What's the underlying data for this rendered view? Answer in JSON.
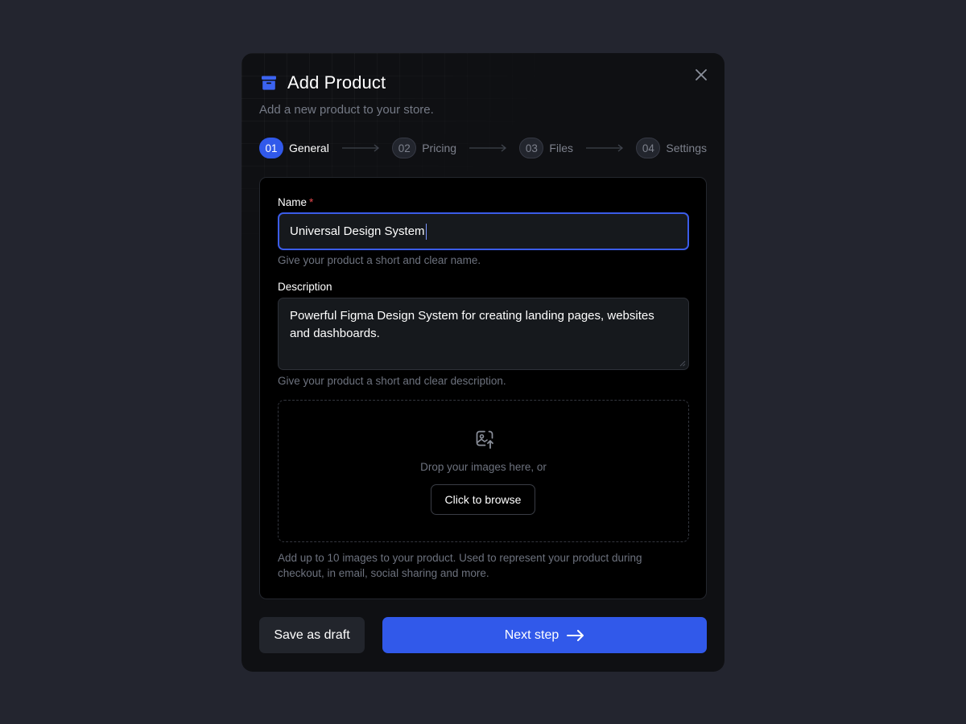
{
  "modal": {
    "title": "Add Product",
    "subtitle": "Add a new product to your store."
  },
  "steps": [
    {
      "number": "01",
      "label": "General",
      "active": true
    },
    {
      "number": "02",
      "label": "Pricing",
      "active": false
    },
    {
      "number": "03",
      "label": "Files",
      "active": false
    },
    {
      "number": "04",
      "label": "Settings",
      "active": false
    }
  ],
  "form": {
    "name": {
      "label": "Name",
      "required_mark": "*",
      "value": "Universal Design System",
      "hint": "Give your product a short and clear name."
    },
    "description": {
      "label": "Description",
      "value": "Powerful Figma Design System for creating landing pages, websites and dashboards.",
      "hint": "Give your product a short and clear description."
    },
    "images": {
      "drop_text": "Drop your images here, or",
      "browse_label": "Click to browse",
      "hint": "Add up to 10 images to your product. Used to represent your product during checkout, in email, social sharing and more."
    }
  },
  "footer": {
    "draft_label": "Save as draft",
    "next_label": "Next step"
  },
  "colors": {
    "accent": "#3159ea",
    "required": "#e5484d",
    "background": "#23252f",
    "modal": "#0f1013"
  },
  "icons": {
    "header": "archive-box-icon",
    "close": "close-icon",
    "step_arrow": "arrow-right-icon",
    "dropzone": "image-upload-icon",
    "next": "arrow-right-icon"
  }
}
